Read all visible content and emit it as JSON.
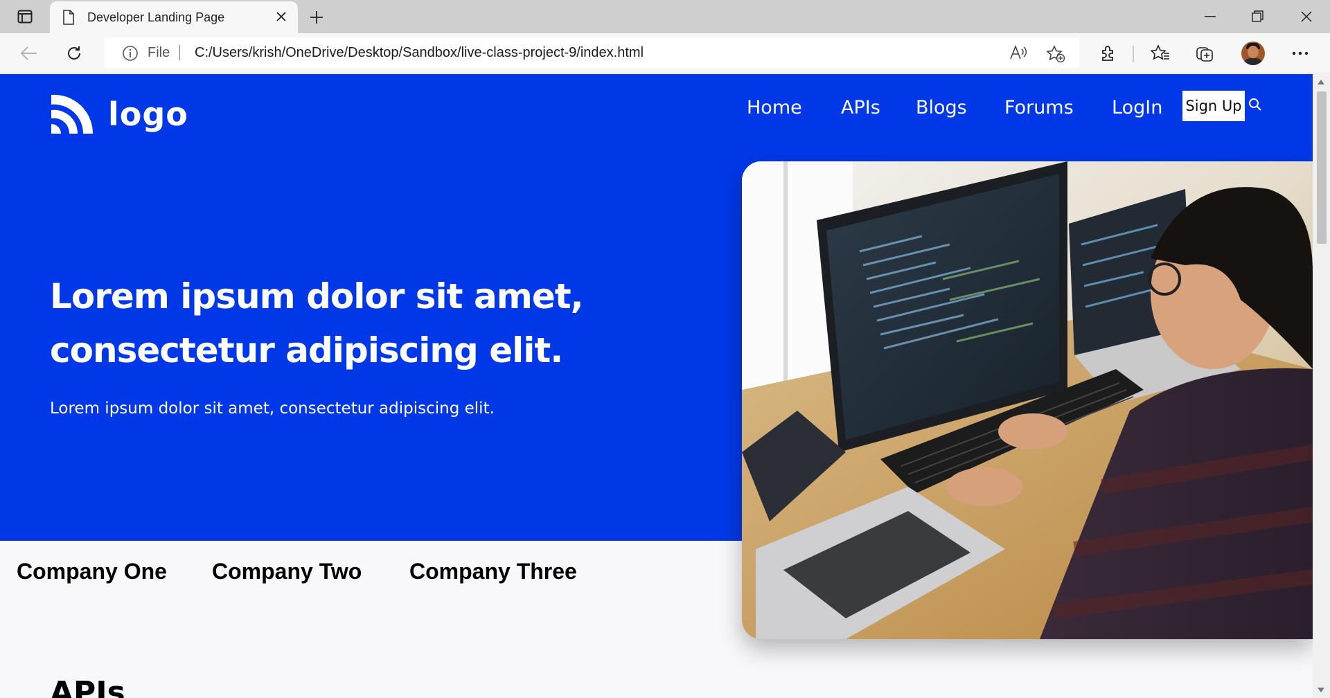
{
  "browser": {
    "tab_title": "Developer Landing Page",
    "address_prefix": "File",
    "url": "C:/Users/krish/OneDrive/Desktop/Sandbox/live-class-project-9/index.html"
  },
  "site": {
    "logo_text": "logo",
    "nav": {
      "items": [
        {
          "label": "Home"
        },
        {
          "label": "APIs"
        },
        {
          "label": "Blogs"
        },
        {
          "label": "Forums"
        },
        {
          "label": "LogIn"
        }
      ],
      "signup_label": "Sign Up"
    },
    "hero": {
      "title": "Lorem ipsum dolor sit amet, consectetur adipiscing elit.",
      "subtitle": "Lorem ipsum dolor sit amet, consectetur adipiscing elit."
    },
    "companies": [
      {
        "name": "Company One"
      },
      {
        "name": "Company Two"
      },
      {
        "name": "Company Three"
      }
    ],
    "section_heading": "APIs"
  },
  "colors": {
    "brand_blue": "#0038e8",
    "page_bg": "#f8f8fa"
  }
}
